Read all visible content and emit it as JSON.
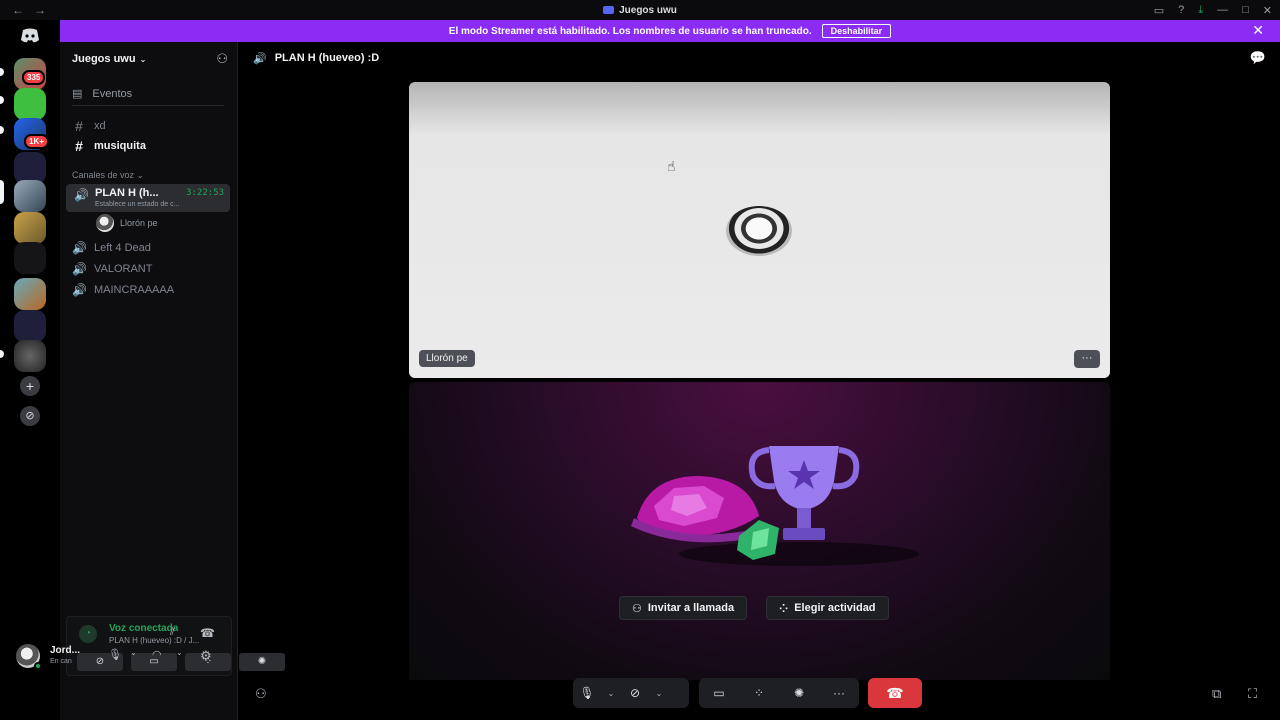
{
  "window": {
    "title": "Juegos uwu",
    "nav_back": "←",
    "nav_forward": "→",
    "controls": [
      "▭",
      "?",
      "⤓",
      "—",
      "□",
      "✕"
    ]
  },
  "banner": {
    "text": "El modo Streamer está habilitado. Los nombres de usuario se han truncado.",
    "button": "Deshabilitar",
    "close": "✕"
  },
  "rail": {
    "badges": [
      "335",
      "1K+"
    ],
    "add_icon": "+",
    "discover_icon": "⊘"
  },
  "sidebar": {
    "guild_name": "Juegos uwu",
    "guild_chevron": "⌄",
    "events_label": "Eventos",
    "text_channels": [
      {
        "name": "xd"
      },
      {
        "name": "musiquita"
      }
    ],
    "voice_category": "Canales de voz",
    "active_voice": {
      "name": "PLAN H (h...",
      "time": "3:22:53",
      "status": "Establece un estado de c..."
    },
    "connected_user": "Llorón pe",
    "voice_channels": [
      "Left 4 Dead",
      "VALORANT",
      "MAINCRAAAAA"
    ]
  },
  "voice_panel": {
    "title": "Voz conectada",
    "subtitle": "PLAN H (hueveo) :D / J...",
    "buttons": [
      "⊘",
      "▭",
      "⁘",
      "✺"
    ]
  },
  "user": {
    "name": "Jord...",
    "status": "En can"
  },
  "main": {
    "channel_title": "PLAN H (hueveo) :D",
    "tile_user_label": "Llorón pe",
    "tile_more": "···",
    "invite_button": "Invitar a llamada",
    "activity_button": "Elegir actividad"
  },
  "icons": {
    "speaker": "🔊",
    "hash": "#",
    "calendar": "▤",
    "add_member": "⚇",
    "chat": "💬"
  }
}
